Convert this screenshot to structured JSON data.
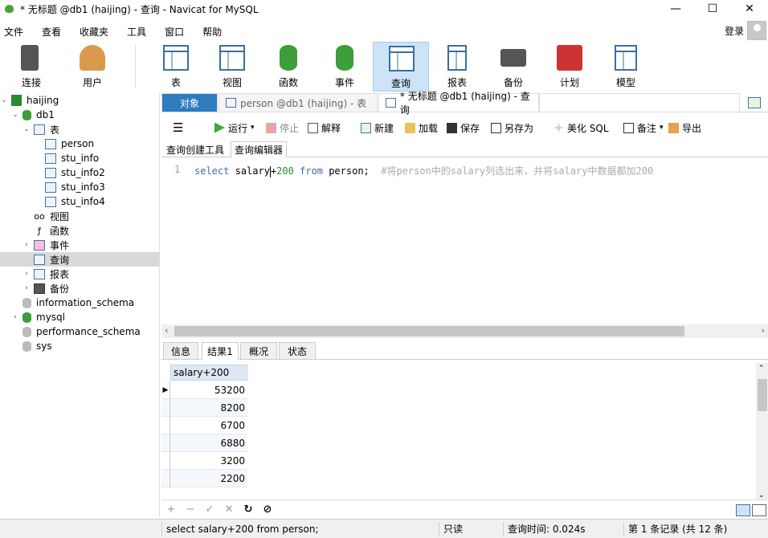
{
  "window": {
    "title": "* 无标题 @db1 (haijing) - 查询 - Navicat for MySQL",
    "minimize": "—",
    "maximize": "☐",
    "close": "✕"
  },
  "menu": [
    "文件",
    "查看",
    "收藏夹",
    "工具",
    "窗口",
    "帮助"
  ],
  "login": "登录",
  "toolbar": [
    {
      "label": "连接",
      "icon": "plug-icon"
    },
    {
      "label": "用户",
      "icon": "user-icon"
    },
    {
      "label": "表",
      "icon": "table-icon"
    },
    {
      "label": "视图",
      "icon": "view-icon"
    },
    {
      "label": "函数",
      "icon": "function-icon"
    },
    {
      "label": "事件",
      "icon": "event-icon"
    },
    {
      "label": "查询",
      "icon": "query-icon"
    },
    {
      "label": "报表",
      "icon": "report-icon"
    },
    {
      "label": "备份",
      "icon": "backup-icon"
    },
    {
      "label": "计划",
      "icon": "schedule-icon"
    },
    {
      "label": "模型",
      "icon": "model-icon"
    }
  ],
  "tree": {
    "connection": "haijing",
    "db": "db1",
    "tables_label": "表",
    "tables": [
      "person",
      "stu_info",
      "stu_info2",
      "stu_info3",
      "stu_info4"
    ],
    "views": "视图",
    "functions": "函数",
    "events": "事件",
    "queries": "查询",
    "reports": "报表",
    "backups": "备份",
    "other_dbs": [
      "information_schema",
      "mysql",
      "performance_schema",
      "sys"
    ]
  },
  "tabs": {
    "objects": "对象",
    "tab1": "person @db1 (haijing) - 表",
    "tab2": "* 无标题 @db1 (haijing) - 查询"
  },
  "query_toolbar": {
    "run": "运行",
    "stop": "停止",
    "explain": "解释",
    "new": "新建",
    "load": "加载",
    "save": "保存",
    "save_as": "另存为",
    "beautify": "美化 SQL",
    "comment": "备注",
    "export": "导出"
  },
  "editor_tabs": {
    "builder": "查询创建工具",
    "editor": "查询编辑器"
  },
  "editor": {
    "line": "1",
    "kw_select": "select",
    "col": " salary",
    "op": "+",
    "num": "200",
    "kw_from": " from",
    "rest": " person;  ",
    "comment": "#将person中的salary列选出来，并将salary中数据都加200"
  },
  "result_tabs": {
    "info": "信息",
    "result": "结果1",
    "profile": "概况",
    "status": "状态"
  },
  "grid": {
    "header": "salary+200",
    "rows": [
      "53200",
      "8200",
      "6700",
      "6880",
      "3200",
      "2200"
    ]
  },
  "grid_buttons": [
    "+",
    "−",
    "✓",
    "✕",
    "↻",
    "⊘"
  ],
  "status": {
    "sql": "select salary+200 from person;",
    "readonly": "只读",
    "time": "查询时间: 0.024s",
    "records": "第 1 条记录 (共 12 条)"
  }
}
